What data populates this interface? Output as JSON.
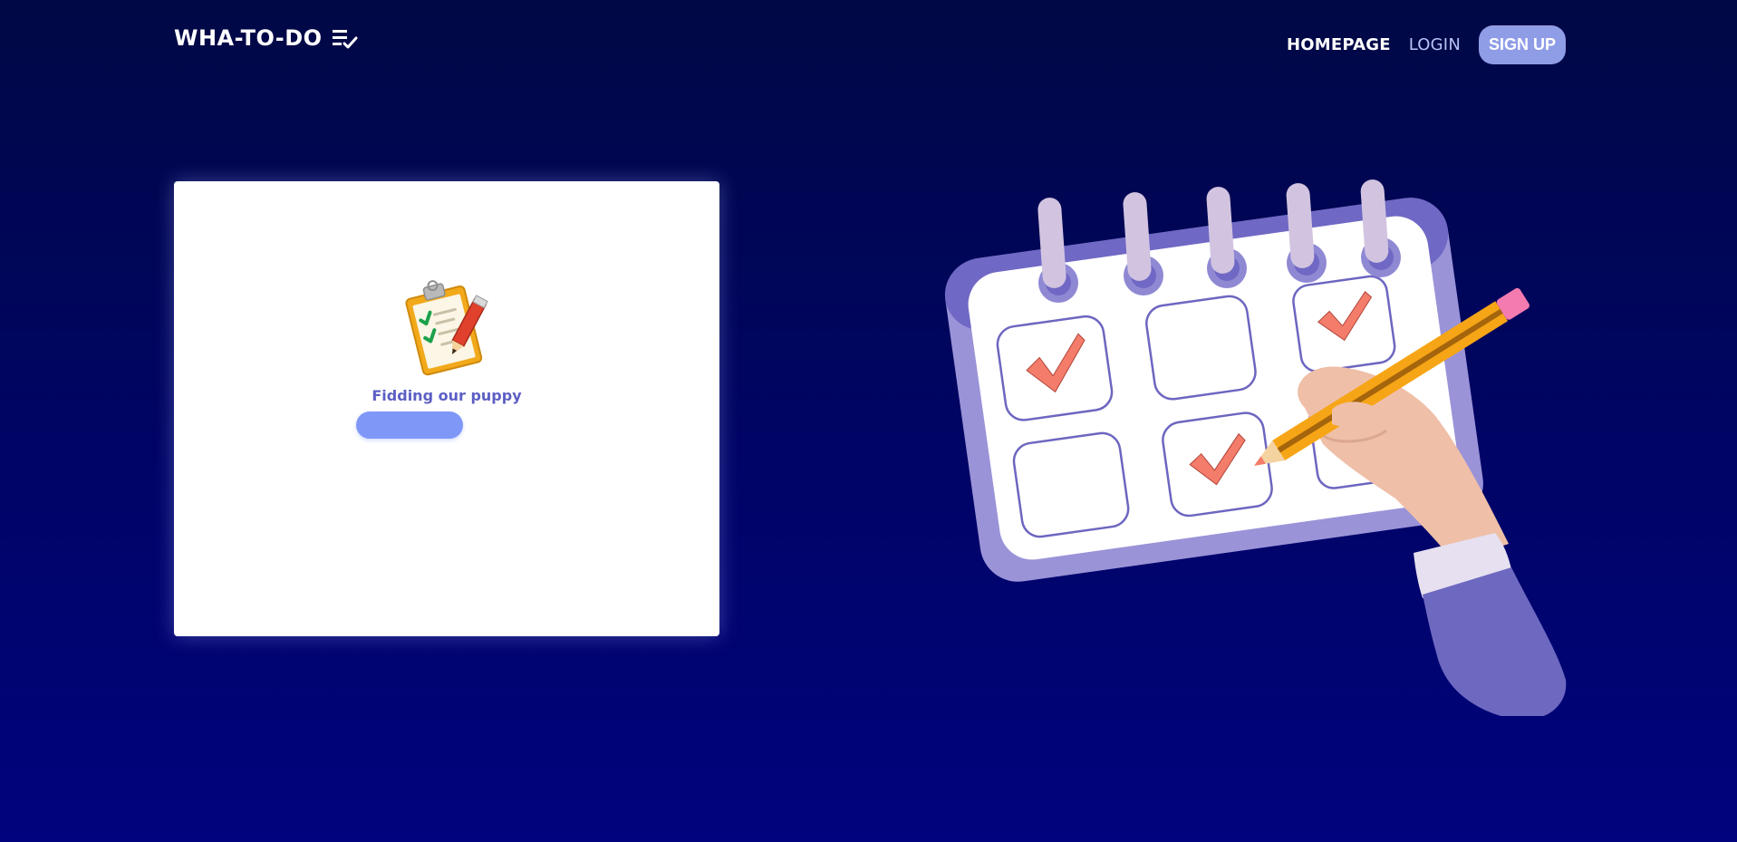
{
  "header": {
    "brand": "WHA-TO-DO",
    "brand_icon": "checklist-icon",
    "nav": {
      "homepage": "HOMEPAGE",
      "login": "LOGIN",
      "signup": "SIGN UP"
    }
  },
  "card": {
    "image_icon": "clipboard-checklist-icon",
    "caption": "Fidding our puppy",
    "button_label": ""
  },
  "illustration": {
    "name": "calendar-checklist-illustration"
  },
  "colors": {
    "background_top": "#000845",
    "background_bottom": "#00037d",
    "accent": "#8f9ce6",
    "button": "#7f97f7",
    "caption": "#5c5fc4",
    "check": "#f47c6a"
  }
}
